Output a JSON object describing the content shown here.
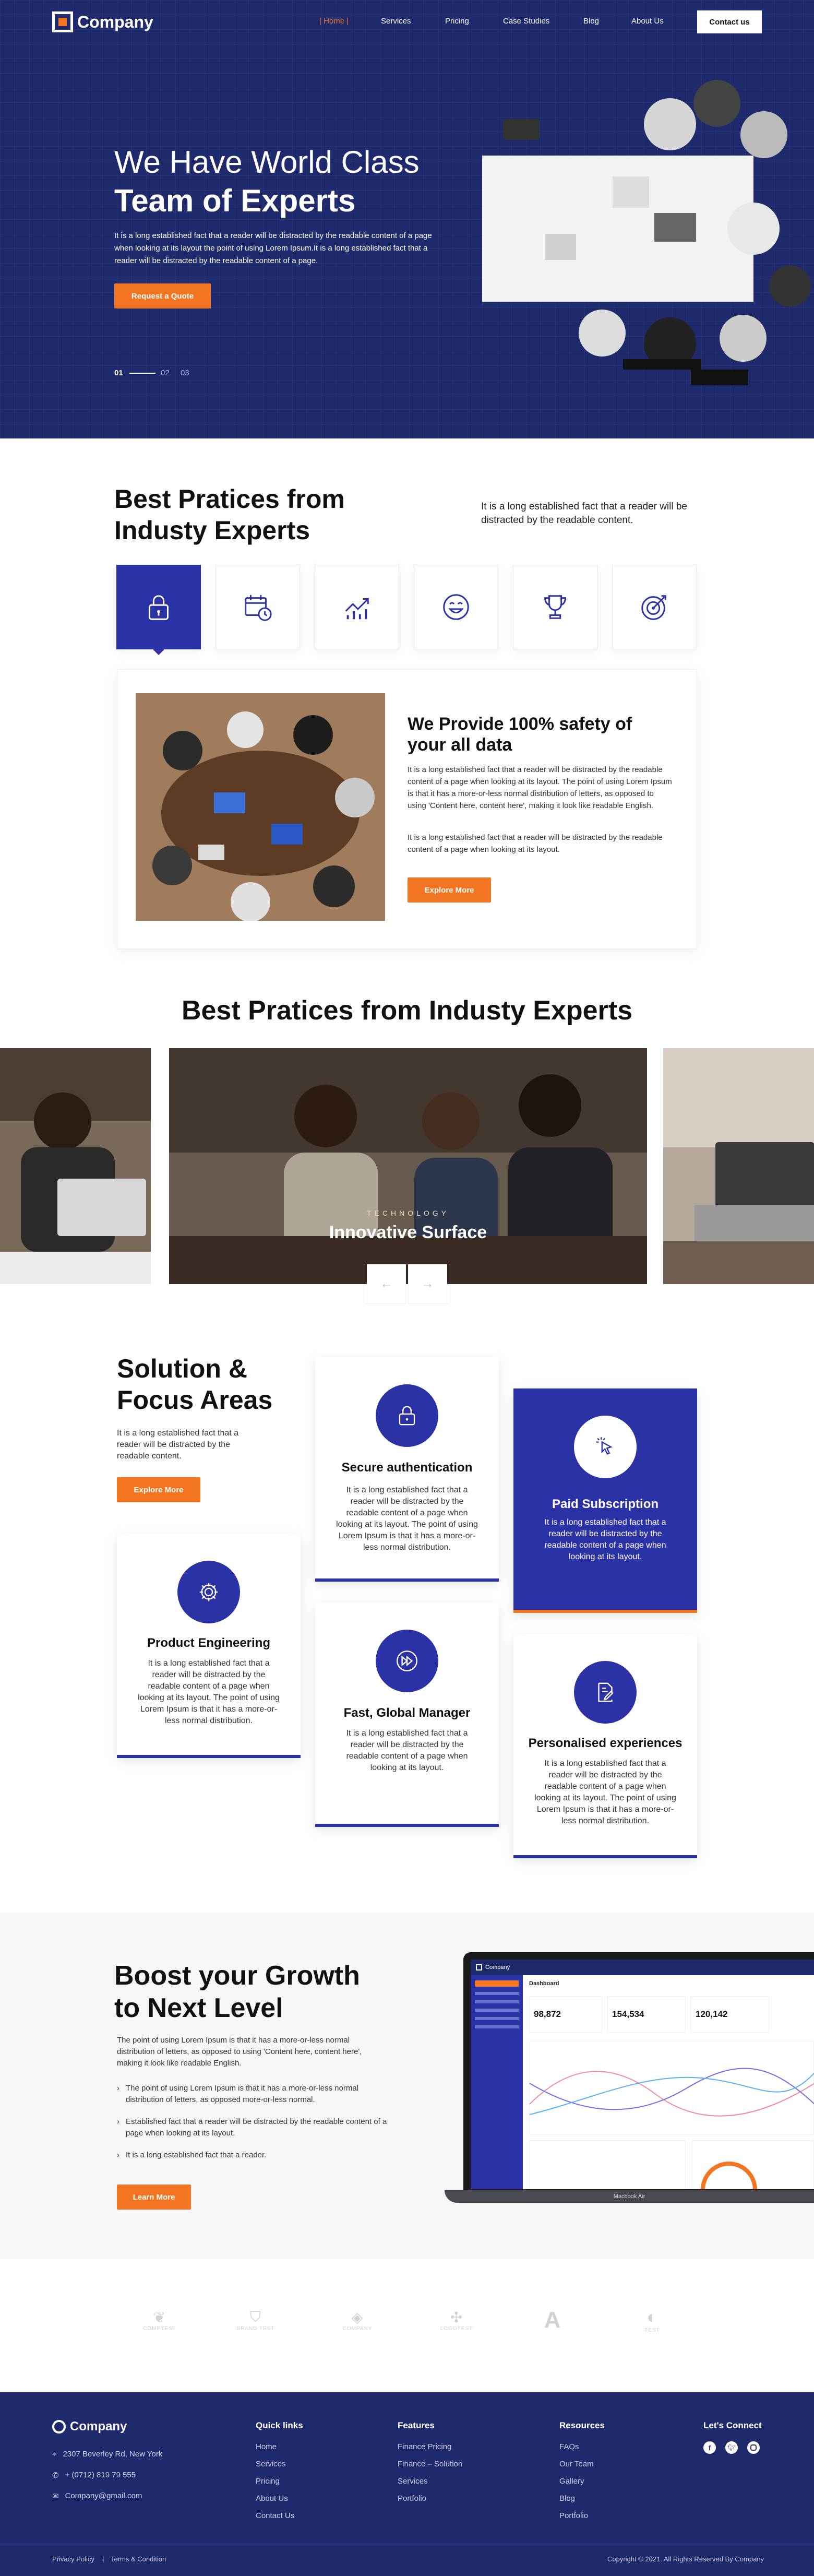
{
  "header": {
    "brand": "Company",
    "nav": [
      "Home",
      "Services",
      "Pricing",
      "Case Studies",
      "Blog",
      "About Us"
    ],
    "contact_label": "Contact us"
  },
  "hero": {
    "title_light": "We Have World Class",
    "title_bold": "Team of Experts",
    "description": "It is a long established fact that a reader will be distracted by the readable content of a page when looking at its layout the point of using Lorem Ipsum.It is a long established fact that a reader will be distracted by the readable content of a page.",
    "cta_label": "Request a Quote",
    "slides": [
      "01",
      "02",
      "03"
    ]
  },
  "practices": {
    "title_line1": "Best Pratices from",
    "title_line2": "Industy Experts",
    "intro": "It is a long established fact that a reader will be distracted by the readable content.",
    "icons": [
      "lock-icon",
      "calendar-clock-icon",
      "growth-chart-icon",
      "smiley-icon",
      "trophy-icon",
      "target-icon"
    ],
    "card_title_line1": "We Provide 100% safety of",
    "card_title_line2": "your all data",
    "card_p1": "It is a long established fact that a reader will be distracted by the readable content of a page when looking at its layout. The point of using Lorem Ipsum is that it has a more-or-less normal distribution of letters, as opposed to using 'Content here, content here', making it look like readable English.",
    "card_p2": "It is a long established fact that a reader will be distracted by the readable content of a page when looking at its layout.",
    "card_cta": "Explore More"
  },
  "carousel": {
    "title": "Best Pratices from Industy Experts",
    "eyebrow": "TECHNOLOGY",
    "caption": "Innovative Surface",
    "prev": "←",
    "next": "→"
  },
  "solutions": {
    "title_line1": "Solution &",
    "title_line2": "Focus Areas",
    "intro": "It is a long established fact that a reader will be distracted by the readable content.",
    "cta": "Explore More",
    "cards": [
      {
        "title": "Secure authentication",
        "text": "It is a long established fact that a reader will be distracted by the readable content of a page when looking at its layout. The point of using Lorem Ipsum is that it has a more-or-less normal distribution.",
        "icon": "lock-icon"
      },
      {
        "title": "Paid Subscription",
        "text": "It is a long established fact that a reader will be distracted by the readable content of a page when looking at its layout.",
        "icon": "cursor-click-icon"
      },
      {
        "title": "Product Engineering",
        "text": "It is a long established fact that a reader will be distracted by the readable content of a page when looking at its layout. The point of using Lorem Ipsum is that it has a more-or-less normal distribution.",
        "icon": "gear-icon"
      },
      {
        "title": "Fast, Global Manager",
        "text": "It is a long established fact that a reader will be distracted by the readable content of a page when looking at its layout.",
        "icon": "fast-forward-icon"
      },
      {
        "title": "Personalised experiences",
        "text": "It is a long established fact that a reader will be distracted by the readable content of a page when looking at its layout. The point of using Lorem Ipsum is that it has a more-or-less normal distribution.",
        "icon": "document-edit-icon"
      }
    ]
  },
  "growth": {
    "title_line1": "Boost your Growth",
    "title_line2": "to Next Level",
    "intro": "The point of using Lorem Ipsum is that it has a more-or-less normal distribution of letters, as opposed to using 'Content here, content here', making it look like readable English.",
    "bullets": [
      "The point of using Lorem Ipsum is that it has a more-or-less normal distribution of letters, as opposed  more-or-less normal.",
      "Established fact that a reader will be distracted by the readable content of a page when looking at its layout.",
      "It is a long established fact that a reader."
    ],
    "cta": "Learn More",
    "laptop": {
      "brand": "Company",
      "page": "Dashboard",
      "stats": [
        "98,872",
        "154,534",
        "120,142"
      ],
      "caption": "Macbook Air"
    }
  },
  "logos": [
    "COMPTEST",
    "BRAND TEST",
    "COMPANY",
    "LOGOTEST",
    "A",
    "TEST"
  ],
  "footer": {
    "brand": "Company",
    "address": "2307 Beverley Rd, New York",
    "phone": "+ (0712) 819 79 555",
    "email": "Company@gmail.com",
    "col1_title": "Quick links",
    "col1": [
      "Home",
      "Services",
      "Pricing",
      "About Us",
      "Contact Us"
    ],
    "col2_title": "Features",
    "col2": [
      "Finance Pricing",
      "Finance – Solution",
      "Services",
      "Portfolio"
    ],
    "col3_title": "Resources",
    "col3": [
      "FAQs",
      "Our Team",
      "Gallery",
      "Blog",
      "Portfolio"
    ],
    "col4_title": "Let's Connect",
    "privacy": "Privacy Policy",
    "terms": "Terms & Condition",
    "copyright": "Copyright © 2021. All Rights Reserved By Company"
  },
  "colors": {
    "navy": "#1e2a6b",
    "accent": "#f37521",
    "brand_blue": "#2b32a6"
  }
}
